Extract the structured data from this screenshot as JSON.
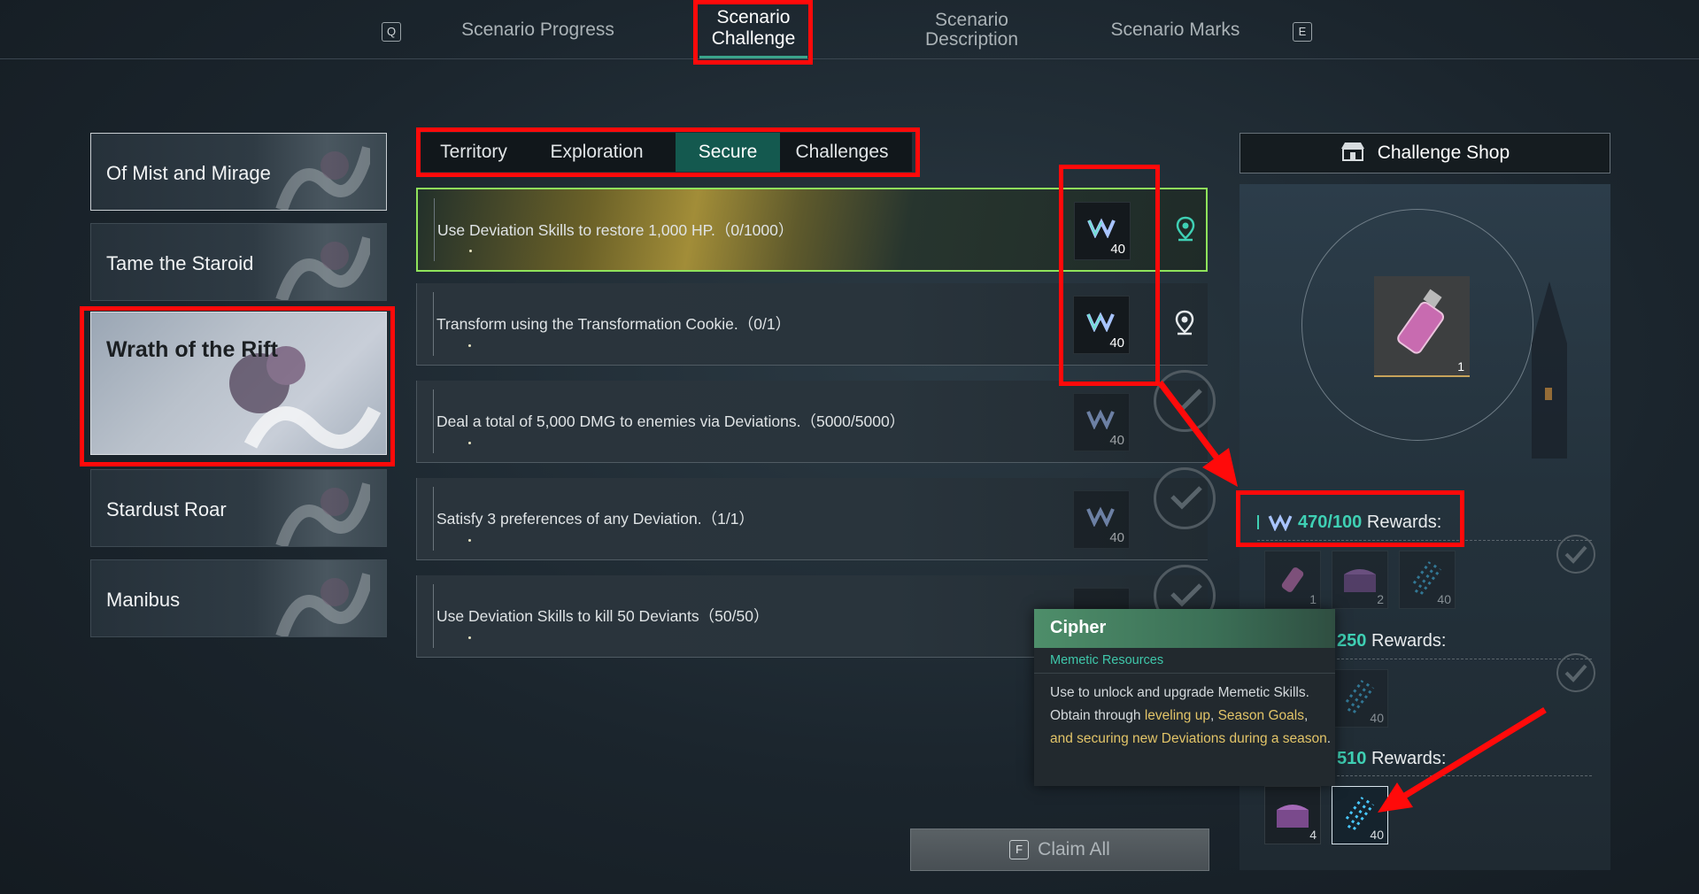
{
  "topnav": {
    "prev_key": "Q",
    "next_key": "E",
    "tabs": [
      {
        "label": "Scenario Progress",
        "active": false
      },
      {
        "label_lines": [
          "Scenario",
          "Challenge"
        ],
        "active": true
      },
      {
        "label_lines": [
          "Scenario",
          "Description"
        ],
        "active": false
      },
      {
        "label": "Scenario Marks",
        "active": false
      }
    ]
  },
  "scenarios": [
    {
      "label": "Of Mist and Mirage",
      "selected": false
    },
    {
      "label": "Tame the Staroid",
      "selected": false
    },
    {
      "label": "Wrath of the Rift",
      "selected": true
    },
    {
      "label": "Stardust Roar",
      "selected": false
    },
    {
      "label": "Manibus",
      "selected": false
    }
  ],
  "categories": [
    {
      "label": "Territory",
      "active": false
    },
    {
      "label": "Exploration",
      "active": false
    },
    {
      "label": "Secure",
      "active": true
    },
    {
      "label": "Challenges",
      "active": false
    }
  ],
  "tasks": [
    {
      "text": "Use Deviation Skills to restore 1,000 HP.（0/1000）",
      "reward_count": "40",
      "status": "in-progress",
      "highlighted": true,
      "pin": "map-pin-teal-icon"
    },
    {
      "text": "Transform using the Transformation Cookie.（0/1）",
      "reward_count": "40",
      "status": "in-progress",
      "highlighted": false,
      "pin": "map-pin-icon"
    },
    {
      "text": "Deal a total of 5,000 DMG to enemies via Deviations.（5000/5000）",
      "reward_count": "40",
      "status": "completed"
    },
    {
      "text": "Satisfy 3 preferences of any Deviation.（1/1）",
      "reward_count": "40",
      "status": "completed"
    },
    {
      "text": "Use Deviation Skills to kill 50 Deviants（50/50）",
      "reward_count": "",
      "status": "completed"
    }
  ],
  "shop": {
    "title": "Challenge Shop",
    "featured_item_count": "1"
  },
  "progress": {
    "current": "470",
    "target": "100",
    "separator": "/",
    "rewards_label": "Rewards:"
  },
  "milestones": [
    {
      "threshold": "100",
      "claimed": true,
      "items": [
        {
          "icon": "vial-icon",
          "count": "1"
        },
        {
          "icon": "chest-icon",
          "count": "2"
        },
        {
          "icon": "cipher-icon",
          "count": "40"
        }
      ]
    },
    {
      "threshold": "250",
      "label": "250",
      "rewards_label": "Rewards:",
      "claimed": true,
      "items": [
        {
          "icon": "cipher-icon",
          "count": "40"
        }
      ]
    },
    {
      "threshold": "510",
      "label": "510",
      "rewards_label": "Rewards:",
      "claimed": false,
      "items": [
        {
          "icon": "chest-icon",
          "count": "4"
        },
        {
          "icon": "cipher-icon",
          "count": "40",
          "selected": true
        }
      ]
    }
  ],
  "tooltip": {
    "title": "Cipher",
    "subtitle": "Memetic Resources",
    "desc_1": "Use to unlock and upgrade Memetic Skills. Obtain through ",
    "link_1": "leveling up",
    "sep_1": ", ",
    "link_2": "Season Goals",
    "sep_2": ", ",
    "link_3": "and securing new Deviations during a season",
    "desc_end": "."
  },
  "claim_all": {
    "key": "F",
    "label": "Claim All"
  },
  "colors": {
    "accent_teal": "#3fd0b4",
    "active_tab": "#14594f",
    "highlight_green": "#8fe35b",
    "annotation_red": "#ff0a0a"
  }
}
